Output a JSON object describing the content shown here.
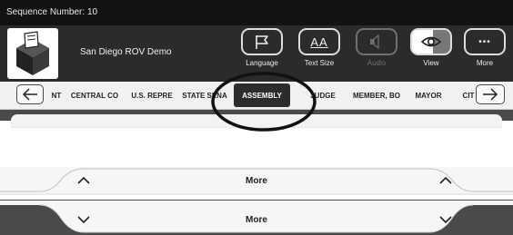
{
  "header": {
    "sequence_label": "Sequence Number: 10",
    "org_name": "San Diego ROV Demo"
  },
  "toolbar": {
    "language": "Language",
    "text_size": "Text Size",
    "text_size_glyph": "AA",
    "audio": "Audio",
    "view": "View",
    "more": "More",
    "more_glyph": "•••"
  },
  "tabs": [
    {
      "label": "NT"
    },
    {
      "label": "CENTRAL CO"
    },
    {
      "label": "U.S. REPRE"
    },
    {
      "label": "STATE SENA"
    },
    {
      "label": "ASSEMBLY"
    },
    {
      "label": "JUDGE"
    },
    {
      "label": "MEMBER, BO"
    },
    {
      "label": "MAYOR"
    },
    {
      "label": "CIT"
    }
  ],
  "scroll": {
    "up_label": "More",
    "down_label": "More"
  },
  "colors": {
    "header": "#2b2b2b",
    "sequence_bar": "#121212",
    "active_tab": "#2c2c2c"
  }
}
